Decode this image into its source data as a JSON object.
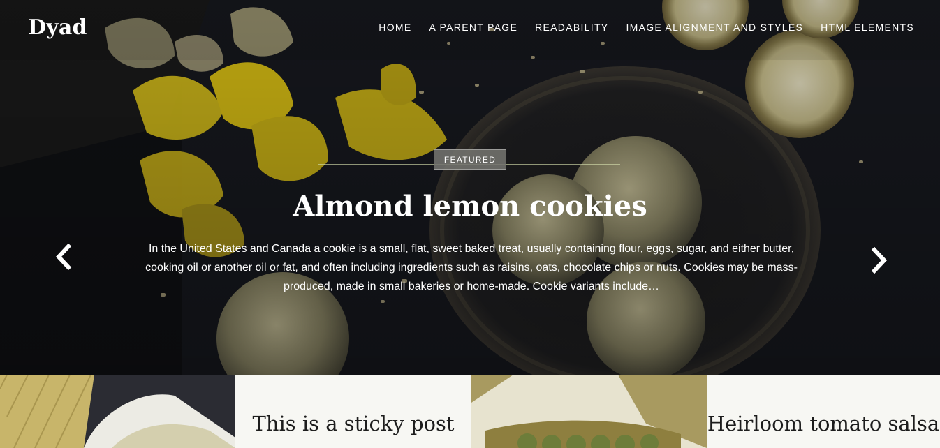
{
  "site": {
    "title": "Dyad"
  },
  "nav": {
    "items": [
      {
        "label": "HOME"
      },
      {
        "label": "A PARENT PAGE"
      },
      {
        "label": "READABILITY"
      },
      {
        "label": "IMAGE ALIGNMENT AND STYLES"
      },
      {
        "label": "HTML ELEMENTS"
      }
    ]
  },
  "hero": {
    "badge": "FEATURED",
    "title": "Almond lemon cookies",
    "excerpt": "In the United States and Canada a cookie is a small, flat, sweet baked treat, usually containing flour, eggs, sugar, and either butter, cooking oil or another oil or fat, and often including ingredients such as raisins, oats, chocolate chips or nuts. Cookies may be mass-produced, made in small bakeries or home-made. Cookie variants include…",
    "prev_icon": "chevron-left-icon",
    "next_icon": "chevron-right-icon"
  },
  "posts": [
    {
      "title": "This is a sticky post"
    },
    {
      "title": "Heirloom tomato salsa"
    }
  ],
  "colors": {
    "accent": "#e0c21b",
    "background": "#15171c",
    "tile_light": "#f7f7f3"
  }
}
